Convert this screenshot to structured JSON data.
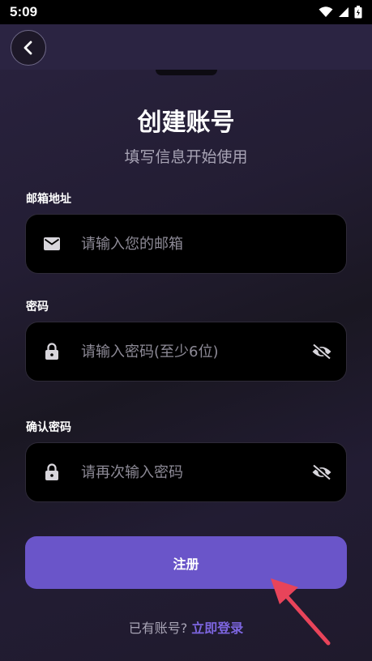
{
  "status_bar": {
    "time": "5:09",
    "icons": [
      "wifi-icon",
      "signal-icon",
      "battery-icon"
    ]
  },
  "header": {
    "back_icon": "chevron-left-icon"
  },
  "page": {
    "title": "创建账号",
    "subtitle": "填写信息开始使用"
  },
  "form": {
    "email": {
      "label": "邮箱地址",
      "placeholder": "请输入您的邮箱",
      "value": "",
      "icon": "mail-icon"
    },
    "password": {
      "label": "密码",
      "placeholder": "请输入密码(至少6位)",
      "value": "",
      "icon": "lock-icon",
      "toggle_icon": "eye-off-icon"
    },
    "confirm_password": {
      "label": "确认密码",
      "placeholder": "请再次输入密码",
      "value": "",
      "icon": "lock-icon",
      "toggle_icon": "eye-off-icon"
    }
  },
  "actions": {
    "register_label": "注册"
  },
  "footer": {
    "have_account": "已有账号?",
    "login_link": "立即登录"
  },
  "colors": {
    "accent": "#6a55c9",
    "link": "#7d66e0",
    "arrow": "#e8445a"
  }
}
